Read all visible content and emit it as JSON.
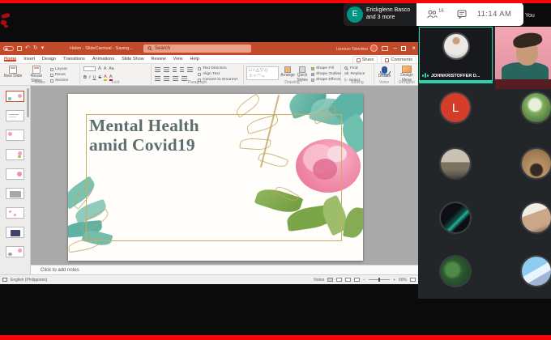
{
  "colors": {
    "top_bottom_bar_red": "#f50707",
    "ppt_titlebar_orange": "#c14a2b",
    "meet_speaking_teal": "#2ed3ae",
    "slide_gold_frame": "#c9ad62",
    "slide_title_text": "#5c6e6e",
    "participant_letter_bg": "#d33d2a"
  },
  "meet": {
    "caption_pill": {
      "avatar_initial": "E",
      "line1": "Erickglenn Basco",
      "line2": "and 3 more"
    },
    "status_pill": {
      "participants_count": "16",
      "time": "11:14 AM"
    },
    "you_label": "You",
    "speaker_tile": {
      "name": "JOHNKRISTOFFER D..."
    },
    "participants": [
      {
        "initial": "L",
        "desc": "letter-avatar"
      },
      {
        "desc": "person-outdoors-photo"
      },
      {
        "desc": "motorbike-photo"
      },
      {
        "desc": "dog-photo"
      },
      {
        "desc": "neon-art-photo"
      },
      {
        "desc": "child-photo"
      },
      {
        "desc": "plant-leaves-photo"
      },
      {
        "desc": "anime-art-photo"
      }
    ]
  },
  "powerpoint": {
    "titlebar": {
      "title": "Helen - SlideCarnival - Saving...",
      "search_placeholder": "Search",
      "account_name": "Lorenzo Tolentino"
    },
    "tabs": [
      "Home",
      "Insert",
      "Design",
      "Transitions",
      "Animations",
      "Slide Show",
      "Review",
      "View",
      "Help"
    ],
    "share_label": "Share",
    "comments_label": "Comments",
    "ribbon": {
      "new_slide": "New Slide",
      "reuse_slides": "Reuse Slides",
      "layout": "Layout",
      "reset": "Reset",
      "section": "Section",
      "text_direction": "Text Direction",
      "align_text": "Align Text",
      "convert_smartart": "Convert to SmartArt",
      "arrange": "Arrange",
      "quick_styles": "Quick Styles",
      "shape_fill": "Shape Fill",
      "shape_outline": "Shape Outline",
      "shape_effects": "Shape Effects",
      "find": "Find",
      "replace": "Replace",
      "select": "Select",
      "dictate": "Dictate",
      "design_ideas": "Design Ideas",
      "group_labels": [
        "Slides",
        "Font",
        "Paragraph",
        "Drawing",
        "Editing",
        "Voice",
        "Designer"
      ]
    },
    "slide": {
      "title_line1": "Mental Health",
      "title_line2": "amid Covid19"
    },
    "notes_placeholder": "Click to add notes",
    "statusbar": {
      "language": "English (Philippines)",
      "notes_label": "Notes",
      "zoom_level": "50%"
    }
  },
  "icons": {
    "undo": "↶",
    "redo": "↻",
    "minimize": "–",
    "close": "×",
    "bold": "B",
    "italic": "I",
    "underline": "U",
    "strikethrough": "S",
    "font_grow": "A",
    "font_shrink": "A",
    "clear_format": "Aa",
    "replace_glyph": "ab",
    "select_arrow": "▷",
    "shapes_row1": "□○△▽◇",
    "shapes_row2": "☆○◠⌣",
    "zoom_minus": "–",
    "zoom_plus": "+",
    "dropdown_caret": "▾"
  }
}
